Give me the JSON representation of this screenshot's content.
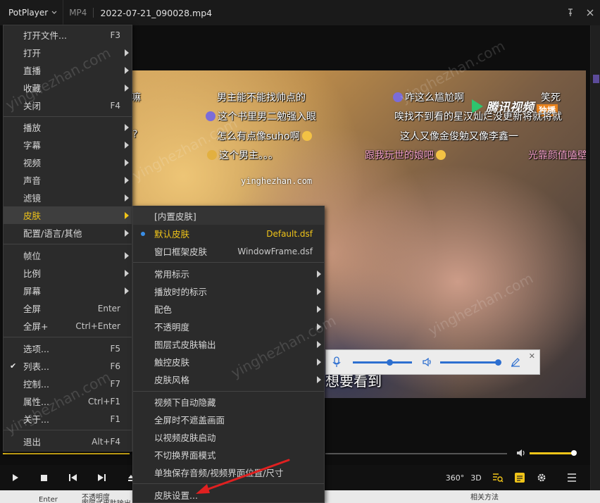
{
  "titlebar": {
    "app_name": "PotPlayer",
    "format": "MP4",
    "filename": "2022-07-21_090028.mp4"
  },
  "video": {
    "brand": "腾讯视频",
    "brand_badge": "独播",
    "subtitle": "想要看到",
    "center_watermark": "yinghezhan.com",
    "danmaku": [
      "嘛",
      "男主能不能找帅点的",
      "咋这么尴尬啊",
      "笑死",
      "这个书里男二勉强入眼",
      "唉找不到看的星汉灿烂没更新将就将就",
      "?",
      "怎么有点像suho啊",
      "这人又像金俊勉又像李鑫一",
      "这个男主。。。",
      "跟我玩世的娘吧",
      "光靠颜值嗑壁"
    ]
  },
  "main_menu": {
    "items": [
      {
        "label": "打开文件...",
        "shortcut": "F3"
      },
      {
        "label": "打开"
      },
      {
        "label": "直播"
      },
      {
        "label": "收藏"
      },
      {
        "label": "关闭",
        "shortcut": "F4"
      },
      {
        "label": "播放"
      },
      {
        "label": "字幕"
      },
      {
        "label": "视频"
      },
      {
        "label": "声音"
      },
      {
        "label": "滤镜"
      },
      {
        "label": "皮肤"
      },
      {
        "label": "配置/语言/其他"
      },
      {
        "label": "帧位"
      },
      {
        "label": "比例"
      },
      {
        "label": "屏幕"
      },
      {
        "label": "全屏",
        "shortcut": "Enter"
      },
      {
        "label": "全屏+",
        "shortcut": "Ctrl+Enter"
      },
      {
        "label": "选项...",
        "shortcut": "F5"
      },
      {
        "label": "列表...",
        "shortcut": "F6"
      },
      {
        "label": "控制...",
        "shortcut": "F7"
      },
      {
        "label": "属性...",
        "shortcut": "Ctrl+F1"
      },
      {
        "label": "关于...",
        "shortcut": "F1"
      },
      {
        "label": "退出",
        "shortcut": "Alt+F4"
      }
    ]
  },
  "skin_menu": {
    "items": [
      {
        "label": "[内置皮肤]"
      },
      {
        "label": "默认皮肤",
        "value": "Default.dsf"
      },
      {
        "label": "窗口框架皮肤",
        "value": "WindowFrame.dsf"
      },
      {
        "label": "常用标示"
      },
      {
        "label": "播放时的标示"
      },
      {
        "label": "配色"
      },
      {
        "label": "不透明度"
      },
      {
        "label": "图层式皮肤输出"
      },
      {
        "label": "触控皮肤"
      },
      {
        "label": "皮肤风格"
      },
      {
        "label": "视频下自动隐藏"
      },
      {
        "label": "全屏时不遮盖画面"
      },
      {
        "label": "以视频皮肤启动"
      },
      {
        "label": "不切换界面模式"
      },
      {
        "label": "单独保存音频/视频界面位置/尺寸"
      },
      {
        "label": "皮肤设置..."
      }
    ]
  },
  "controls": {
    "btn_360": "360°",
    "btn_3d": "3D"
  },
  "playback": {
    "progress": 0.22,
    "volume": 0.92
  },
  "taskbar": {
    "items": [
      "不透明度",
      "Enter",
      "图层式皮肤输出",
      "相关方法"
    ]
  },
  "colors": {
    "accent": "#f0c419",
    "menu_bg": "#2b2b2b",
    "selected_dot": "#3a8ee6",
    "annotation_arrow": "#e02020"
  }
}
